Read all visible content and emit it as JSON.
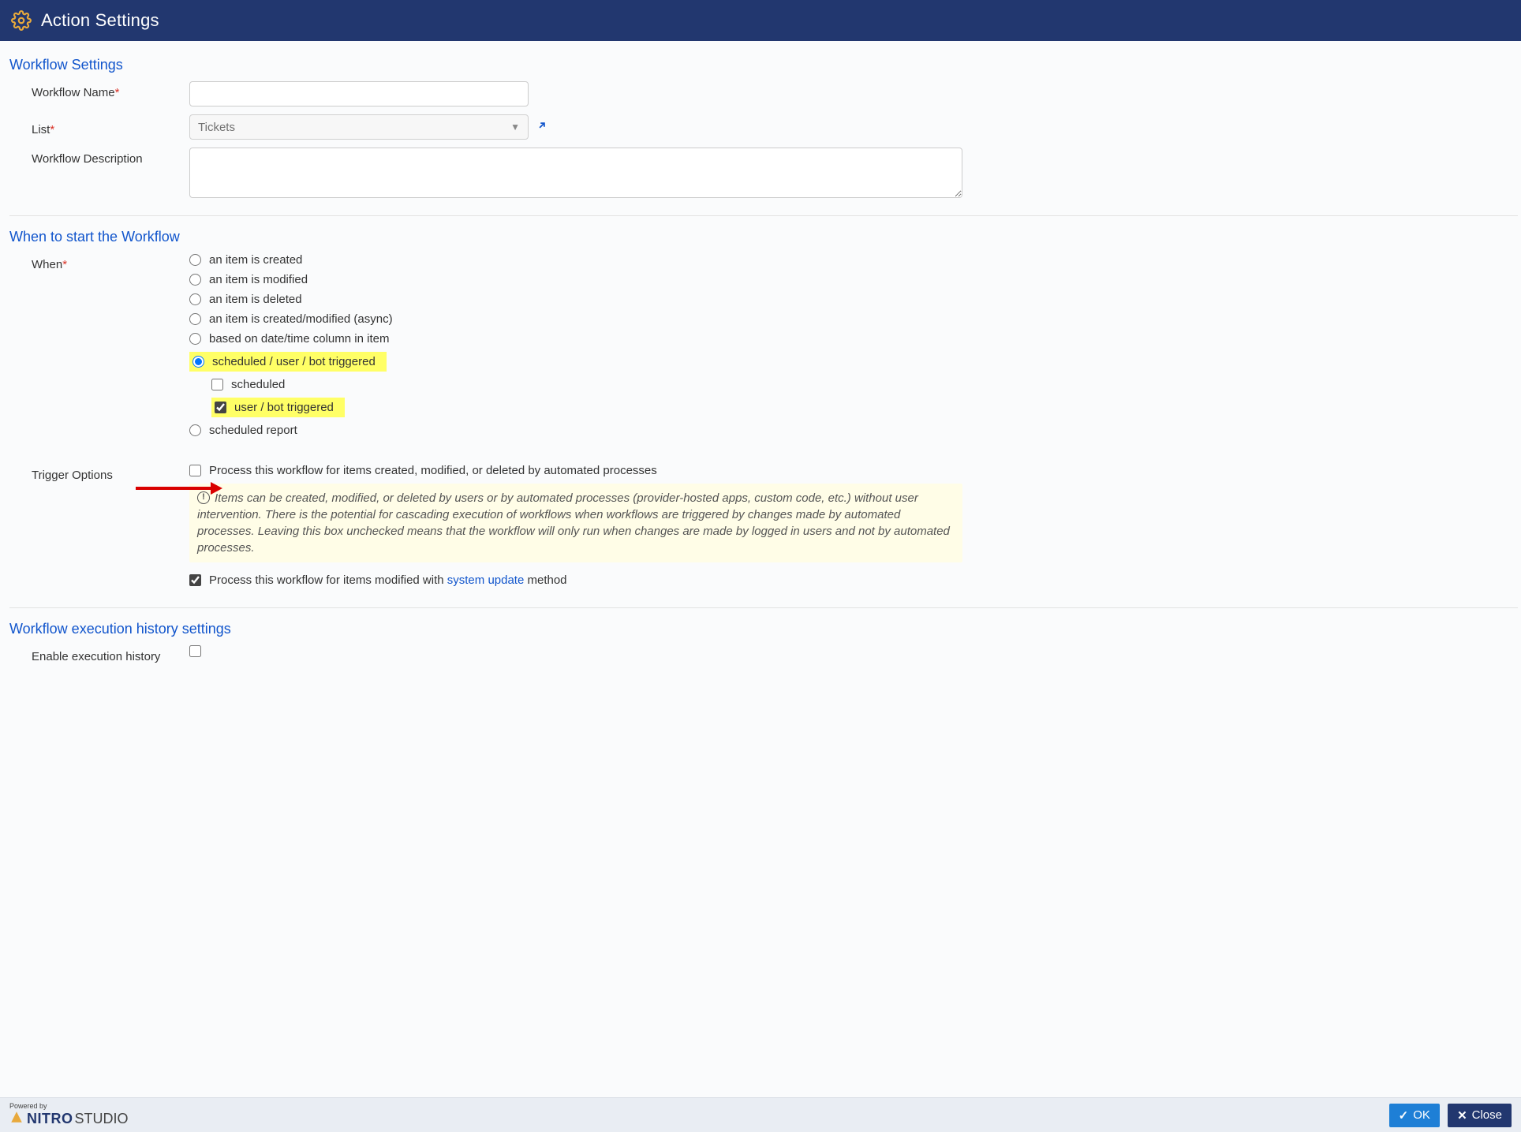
{
  "header": {
    "title": "Action Settings"
  },
  "section_workflow": {
    "title": "Workflow Settings",
    "name_label": "Workflow Name",
    "name_value": "",
    "list_label": "List",
    "list_value": "Tickets",
    "desc_label": "Workflow Description",
    "desc_value": ""
  },
  "section_when": {
    "title": "When to start the Workflow",
    "when_label": "When",
    "options": {
      "created": "an item is created",
      "modified": "an item is modified",
      "deleted": "an item is deleted",
      "created_modified_async": "an item is created/modified (async)",
      "date_time_column": "based on date/time column in item",
      "scheduled_user_bot": "scheduled / user / bot triggered",
      "scheduled": "scheduled",
      "user_bot": "user / bot triggered",
      "scheduled_report": "scheduled report"
    },
    "trigger_label": "Trigger Options",
    "trigger_process_auto": "Process this workflow for items created, modified, or deleted by automated processes",
    "trigger_info": "Items can be created, modified, or deleted by users or by automated processes (provider-hosted apps, custom code, etc.) without user intervention. There is the potential for cascading execution of workflows when workflows are triggered by changes made by automated processes. Leaving this box unchecked means that the workflow will only run when changes are made by logged in users and not by automated processes.",
    "trigger_process_sysupdate_pre": "Process this workflow for items modified with ",
    "trigger_process_sysupdate_link": "system update",
    "trigger_process_sysupdate_post": " method"
  },
  "section_history": {
    "title": "Workflow execution history settings",
    "enable_label": "Enable execution history"
  },
  "footer": {
    "powered_by": "Powered by",
    "brand_main": "NITRO",
    "brand_sub": "STUDIO",
    "ok": "OK",
    "close": "Close"
  }
}
